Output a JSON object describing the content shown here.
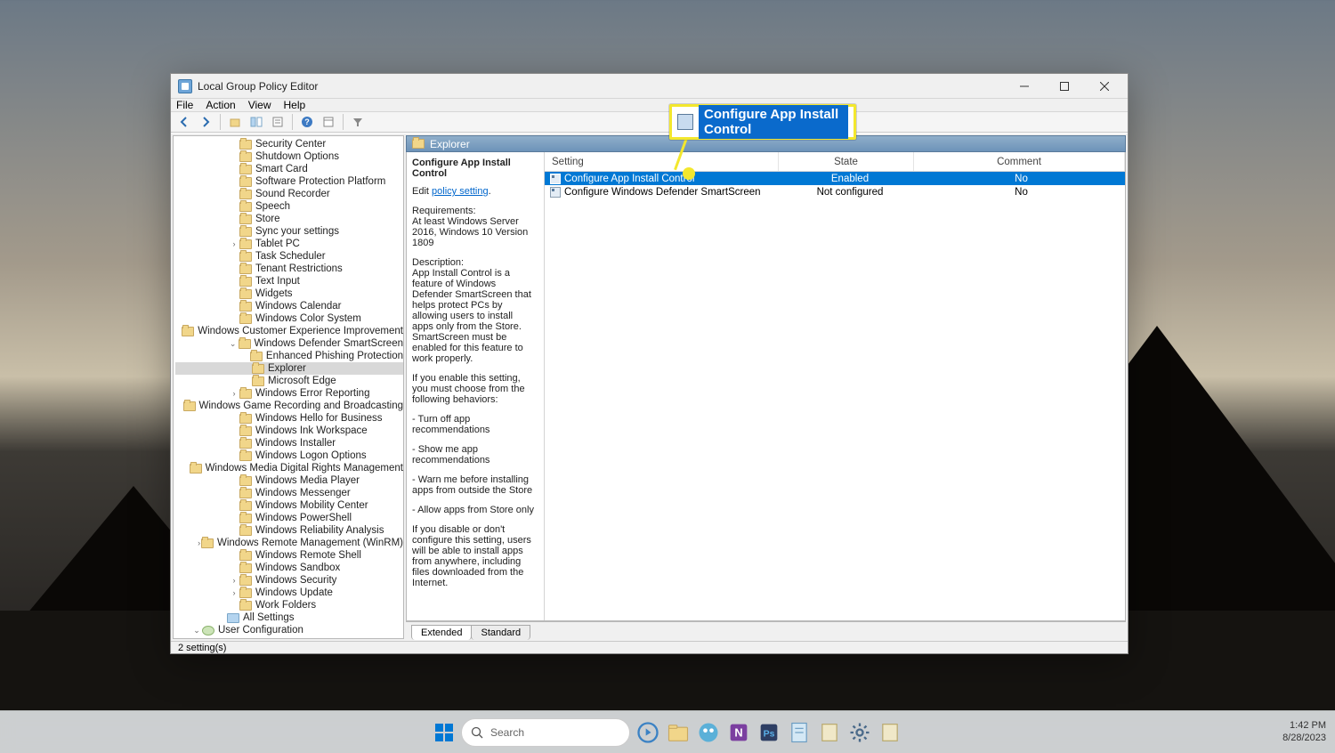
{
  "window": {
    "title": "Local Group Policy Editor",
    "menu": [
      "File",
      "Action",
      "View",
      "Help"
    ],
    "status": "2 setting(s)"
  },
  "tree": [
    {
      "indent": 3,
      "icon": "fld",
      "label": "Security Center"
    },
    {
      "indent": 3,
      "icon": "fld",
      "label": "Shutdown Options"
    },
    {
      "indent": 3,
      "icon": "fld",
      "label": "Smart Card"
    },
    {
      "indent": 3,
      "icon": "fld",
      "label": "Software Protection Platform"
    },
    {
      "indent": 3,
      "icon": "fld",
      "label": "Sound Recorder"
    },
    {
      "indent": 3,
      "icon": "fld",
      "label": "Speech"
    },
    {
      "indent": 3,
      "icon": "fld",
      "label": "Store"
    },
    {
      "indent": 3,
      "icon": "fld",
      "label": "Sync your settings"
    },
    {
      "indent": 3,
      "icon": "fld",
      "label": "Tablet PC",
      "twisty": ">"
    },
    {
      "indent": 3,
      "icon": "fld",
      "label": "Task Scheduler"
    },
    {
      "indent": 3,
      "icon": "fld",
      "label": "Tenant Restrictions"
    },
    {
      "indent": 3,
      "icon": "fld",
      "label": "Text Input"
    },
    {
      "indent": 3,
      "icon": "fld",
      "label": "Widgets"
    },
    {
      "indent": 3,
      "icon": "fld",
      "label": "Windows Calendar"
    },
    {
      "indent": 3,
      "icon": "fld",
      "label": "Windows Color System"
    },
    {
      "indent": 3,
      "icon": "fld",
      "label": "Windows Customer Experience Improvement"
    },
    {
      "indent": 3,
      "icon": "fld",
      "label": "Windows Defender SmartScreen",
      "twisty": "v"
    },
    {
      "indent": 4,
      "icon": "fld",
      "label": "Enhanced Phishing Protection"
    },
    {
      "indent": 4,
      "icon": "fld",
      "label": "Explorer",
      "selected": true
    },
    {
      "indent": 4,
      "icon": "fld",
      "label": "Microsoft Edge"
    },
    {
      "indent": 3,
      "icon": "fld",
      "label": "Windows Error Reporting",
      "twisty": ">"
    },
    {
      "indent": 3,
      "icon": "fld",
      "label": "Windows Game Recording and Broadcasting"
    },
    {
      "indent": 3,
      "icon": "fld",
      "label": "Windows Hello for Business"
    },
    {
      "indent": 3,
      "icon": "fld",
      "label": "Windows Ink Workspace"
    },
    {
      "indent": 3,
      "icon": "fld",
      "label": "Windows Installer"
    },
    {
      "indent": 3,
      "icon": "fld",
      "label": "Windows Logon Options"
    },
    {
      "indent": 3,
      "icon": "fld",
      "label": "Windows Media Digital Rights Management"
    },
    {
      "indent": 3,
      "icon": "fld",
      "label": "Windows Media Player"
    },
    {
      "indent": 3,
      "icon": "fld",
      "label": "Windows Messenger"
    },
    {
      "indent": 3,
      "icon": "fld",
      "label": "Windows Mobility Center"
    },
    {
      "indent": 3,
      "icon": "fld",
      "label": "Windows PowerShell"
    },
    {
      "indent": 3,
      "icon": "fld",
      "label": "Windows Reliability Analysis"
    },
    {
      "indent": 3,
      "icon": "fld",
      "label": "Windows Remote Management (WinRM)",
      "twisty": ">"
    },
    {
      "indent": 3,
      "icon": "fld",
      "label": "Windows Remote Shell"
    },
    {
      "indent": 3,
      "icon": "fld",
      "label": "Windows Sandbox"
    },
    {
      "indent": 3,
      "icon": "fld",
      "label": "Windows Security",
      "twisty": ">"
    },
    {
      "indent": 3,
      "icon": "fld",
      "label": "Windows Update",
      "twisty": ">"
    },
    {
      "indent": 3,
      "icon": "fld",
      "label": "Work Folders"
    },
    {
      "indent": 2,
      "icon": "cfg",
      "label": "All Settings"
    },
    {
      "indent": 0,
      "icon": "usr",
      "label": "User Configuration",
      "twisty": "v"
    }
  ],
  "path": "Explorer",
  "desc": {
    "title": "Configure App Install Control",
    "edit_prefix": "Edit ",
    "edit_link": "policy setting",
    "req_label": "Requirements:",
    "req_text": "At least Windows Server 2016, Windows 10 Version 1809",
    "desc_label": "Description:",
    "p1": "App Install Control is a feature of Windows Defender SmartScreen that helps protect PCs by allowing users to install apps only from the Store. SmartScreen must be enabled for this feature to work properly.",
    "p2": "If you enable this setting, you must choose from the following behaviors:",
    "b1": "   - Turn off app recommendations",
    "b2": "   - Show me app recommendations",
    "b3": "   - Warn me before installing apps from outside the Store",
    "b4": "   - Allow apps from Store only",
    "p3": "If you disable or don't configure this setting, users will be able to install apps from anywhere, including files downloaded from the Internet."
  },
  "columns": {
    "setting": "Setting",
    "state": "State",
    "comment": "Comment"
  },
  "settings": [
    {
      "name": "Configure App Install Control",
      "state": "Enabled",
      "comment": "No",
      "selected": true
    },
    {
      "name": "Configure Windows Defender SmartScreen",
      "state": "Not configured",
      "comment": "No",
      "selected": false
    }
  ],
  "tabs": {
    "extended": "Extended",
    "standard": "Standard"
  },
  "callout": "Configure App Install Control",
  "taskbar": {
    "search_placeholder": "Search",
    "time": "1:42 PM",
    "date": "8/28/2023"
  }
}
